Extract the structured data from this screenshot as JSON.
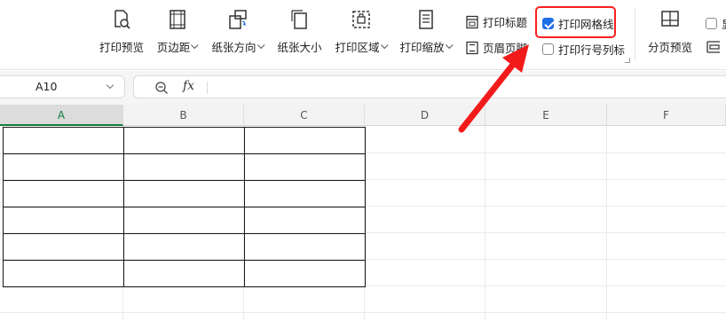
{
  "ribbon": {
    "buttons": [
      {
        "name": "print-preview",
        "label": "打印预览",
        "icon": "print-preview-icon",
        "dropdown": false
      },
      {
        "name": "margins",
        "label": "页边距",
        "icon": "margins-icon",
        "dropdown": true
      },
      {
        "name": "orientation",
        "label": "纸张方向",
        "icon": "orientation-icon",
        "dropdown": true
      },
      {
        "name": "paper-size",
        "label": "纸张大小",
        "icon": "paper-size-icon",
        "dropdown": false
      },
      {
        "name": "print-area",
        "label": "打印区域",
        "icon": "print-area-icon",
        "dropdown": true
      },
      {
        "name": "print-scaling",
        "label": "打印缩放",
        "icon": "print-scaling-icon",
        "dropdown": true
      }
    ],
    "print_titles": "打印标题",
    "header_footer": "页眉页脚",
    "print_gridlines": {
      "label": "打印网格线",
      "checked": true
    },
    "print_headings": {
      "label": "打印行号列标",
      "checked": false
    },
    "page_break_preview": "分页预览",
    "cut_off_label": "显",
    "highlight_color": "#ff1f1f",
    "checkbox_color": "#1f6fe8"
  },
  "formula_bar": {
    "name_box": "A10",
    "fx": "fx",
    "formula": ""
  },
  "sheet": {
    "columns": [
      "A",
      "B",
      "C",
      "D",
      "E",
      "F"
    ],
    "selected_column": "A",
    "selected_color": "#107c41"
  }
}
